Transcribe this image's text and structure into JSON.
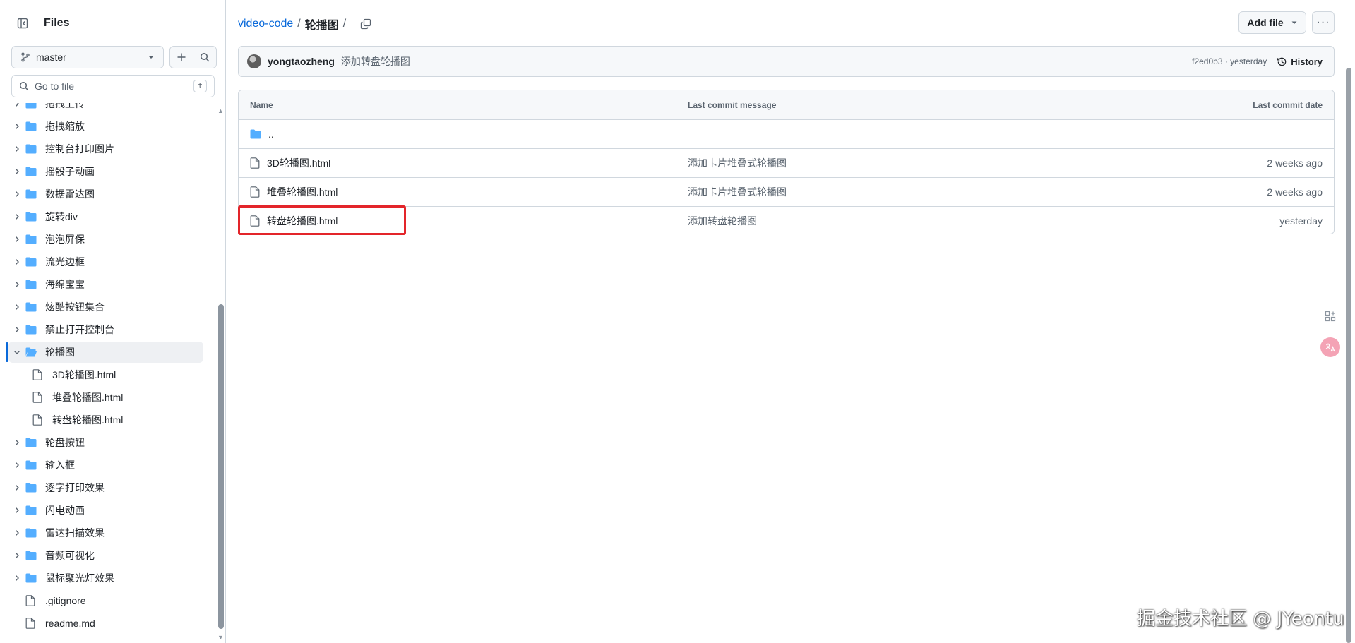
{
  "sidebar": {
    "title": "Files",
    "branch": "master",
    "goto_placeholder": "Go to file",
    "goto_shortcut": "t",
    "items": [
      {
        "label": "拖拽上传",
        "type": "folder"
      },
      {
        "label": "拖拽缩放",
        "type": "folder"
      },
      {
        "label": "控制台打印图片",
        "type": "folder"
      },
      {
        "label": "摇骰子动画",
        "type": "folder"
      },
      {
        "label": "数据雷达图",
        "type": "folder"
      },
      {
        "label": "旋转div",
        "type": "folder"
      },
      {
        "label": "泡泡屏保",
        "type": "folder"
      },
      {
        "label": "流光边框",
        "type": "folder"
      },
      {
        "label": "海绵宝宝",
        "type": "folder"
      },
      {
        "label": "炫酷按钮集合",
        "type": "folder"
      },
      {
        "label": "禁止打开控制台",
        "type": "folder"
      },
      {
        "label": "轮播图",
        "type": "folder-open"
      },
      {
        "label": "3D轮播图.html",
        "type": "file"
      },
      {
        "label": "堆叠轮播图.html",
        "type": "file"
      },
      {
        "label": "转盘轮播图.html",
        "type": "file"
      },
      {
        "label": "轮盘按钮",
        "type": "folder"
      },
      {
        "label": "输入框",
        "type": "folder"
      },
      {
        "label": "逐字打印效果",
        "type": "folder"
      },
      {
        "label": "闪电动画",
        "type": "folder"
      },
      {
        "label": "雷达扫描效果",
        "type": "folder"
      },
      {
        "label": "音频可视化",
        "type": "folder"
      },
      {
        "label": "鼠标聚光灯效果",
        "type": "folder"
      },
      {
        "label": ".gitignore",
        "type": "file"
      },
      {
        "label": "readme.md",
        "type": "file"
      }
    ]
  },
  "breadcrumb": {
    "repo": "video-code",
    "sep": "/",
    "current": "轮播图",
    "trailing": "/"
  },
  "toolbar": {
    "add_file": "Add file",
    "more": "···"
  },
  "commit": {
    "author": "yongtaozheng",
    "message": "添加转盘轮播图",
    "sha_time": "f2ed0b3 · yesterday",
    "history": "History"
  },
  "table": {
    "headers": {
      "name": "Name",
      "message": "Last commit message",
      "date": "Last commit date"
    },
    "parent": "..",
    "rows": [
      {
        "name": "3D轮播图.html",
        "message": "添加卡片堆叠式轮播图",
        "date": "2 weeks ago"
      },
      {
        "name": "堆叠轮播图.html",
        "message": "添加卡片堆叠式轮播图",
        "date": "2 weeks ago"
      },
      {
        "name": "转盘轮播图.html",
        "message": "添加转盘轮播图",
        "date": "yesterday"
      }
    ]
  },
  "watermark": "掘金技术社区 @ JYeontu",
  "colors": {
    "folder": "#54aeff",
    "link": "#0969da",
    "highlight": "#e3252a"
  }
}
